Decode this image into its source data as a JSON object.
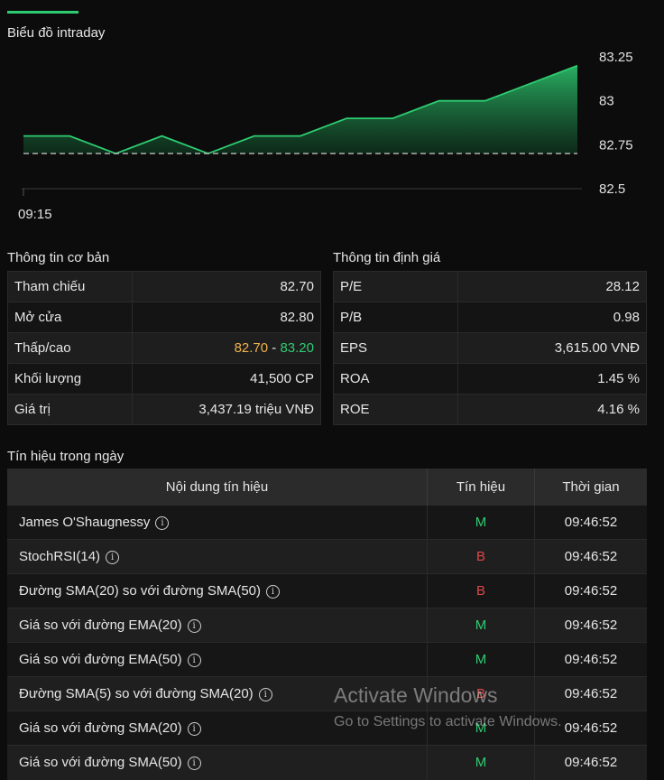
{
  "tabs": {
    "active": ""
  },
  "chart_section": {
    "title": "Biểu đồ intraday"
  },
  "basic_info": {
    "title": "Thông tin cơ bản",
    "rows": [
      {
        "label": "Tham chiếu",
        "value": "82.70"
      },
      {
        "label": "Mở cửa",
        "value": "82.80"
      },
      {
        "label": "Thấp/cao",
        "low": "82.70",
        "sep": " - ",
        "high": "83.20"
      },
      {
        "label": "Khối lượng",
        "value": "41,500 CP"
      },
      {
        "label": "Giá trị",
        "value": "3,437.19 triệu VNĐ"
      }
    ]
  },
  "valuation": {
    "title": "Thông tin định giá",
    "rows": [
      {
        "label": "P/E",
        "value": "28.12"
      },
      {
        "label": "P/B",
        "value": "0.98"
      },
      {
        "label": "EPS",
        "value": "3,615.00 VNĐ"
      },
      {
        "label": "ROA",
        "value": "1.45 %"
      },
      {
        "label": "ROE",
        "value": "4.16 %"
      }
    ]
  },
  "signals": {
    "title": "Tín hiệu trong ngày",
    "headers": [
      "Nội dung tín hiệu",
      "Tín hiệu",
      "Thời gian"
    ],
    "rows": [
      {
        "name": "James O'Shaugnessy",
        "signal": "M",
        "time": "09:46:52"
      },
      {
        "name": "StochRSI(14)",
        "signal": "B",
        "time": "09:46:52"
      },
      {
        "name": "Đường SMA(20) so với đường SMA(50)",
        "signal": "B",
        "time": "09:46:52"
      },
      {
        "name": "Giá so với đường EMA(20)",
        "signal": "M",
        "time": "09:46:52"
      },
      {
        "name": "Giá so với đường EMA(50)",
        "signal": "M",
        "time": "09:46:52"
      },
      {
        "name": "Đường SMA(5) so với đường SMA(20)",
        "signal": "B",
        "time": "09:46:52"
      },
      {
        "name": "Giá so với đường SMA(20)",
        "signal": "M",
        "time": "09:46:52"
      },
      {
        "name": "Giá so với đường SMA(50)",
        "signal": "M",
        "time": "09:46:52"
      }
    ],
    "colors": {
      "M": "#2ecc71",
      "B": "#e04848"
    }
  },
  "chart_data": {
    "type": "area",
    "title": "Biểu đồ intraday",
    "reference": 82.7,
    "ylim": [
      82.5,
      83.25
    ],
    "y_ticks": [
      "83.25",
      "83",
      "82.75",
      "82.5"
    ],
    "x_ticks": [
      "09:15"
    ],
    "series": [
      {
        "values": [
          82.8,
          82.8,
          82.7,
          82.8,
          82.7,
          82.8,
          82.8,
          82.9,
          82.9,
          83.0,
          83.0,
          83.1,
          83.2
        ]
      }
    ],
    "colors": {
      "line": "#2ecc71",
      "fill": "#1f7a42",
      "reference": "#bdbdbd"
    }
  },
  "watermark": {
    "line1": "Activate Windows",
    "line2": "Go to Settings to activate Windows."
  }
}
